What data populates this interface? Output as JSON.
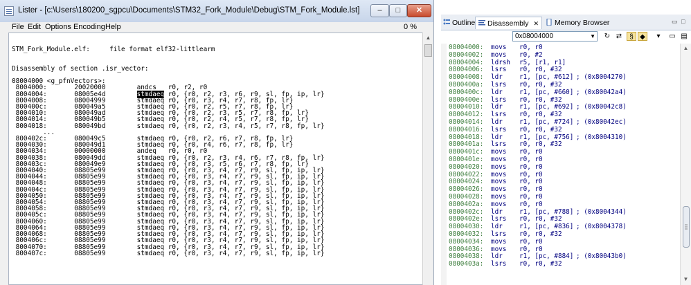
{
  "lister": {
    "title": "Lister - [c:\\Users\\180200_sgpcu\\Documents\\STM32_Fork_Module\\Debug\\STM_Fork_Module.lst]",
    "window_buttons": {
      "minimize": "–",
      "maximize": "□",
      "close": "✕"
    },
    "menu": [
      "File",
      "Edit",
      "Options",
      "Encoding",
      "Help"
    ],
    "percent": "0 %",
    "lines_before": [
      "",
      "STM_Fork_Module.elf:     file format elf32-littlearm",
      "",
      "",
      "Disassembly of section .isr_vector:",
      "",
      "08004000 <g_pfnVectors>:",
      " 8004000:       20020000        andcs   r0, r2, r0"
    ],
    "highlight_line": {
      "prefix": " 8004004:       08005e4d        ",
      "highlight": "stmdaeq",
      "suffix": " r0, {r0, r2, r3, r6, r9, sl, fp, ip, lr}"
    },
    "lines_after": [
      " 8004008:       08004999        stmdaeq r0, {r0, r3, r4, r7, r8, fp, lr}",
      " 800400c:       080049a5        stmdaeq r0, {r0, r2, r5, r7, r8, fp, lr}",
      " 8004010:       080049ad        stmdaeq r0, {r0, r2, r3, r5, r7, r8, fp, lr}",
      " 8004014:       080049b5        stmdaeq r0, {r0, r2, r4, r5, r7, r8, fp, lr}",
      " 8004018:       080049bd        stmdaeq r0, {r0, r2, r3, r4, r5, r7, r8, fp, lr}",
      "        ...",
      " 800402c:       080049c5        stmdaeq r0, {r0, r2, r6, r7, r8, fp, lr}",
      " 8004030:       080049d1        stmdaeq r0, {r0, r4, r6, r7, r8, fp, lr}",
      " 8004034:       00000000        andeq   r0, r0, r0",
      " 8004038:       080049dd        stmdaeq r0, {r0, r2, r3, r4, r6, r7, r8, fp, lr}",
      " 800403c:       080049e9        stmdaeq r0, {r0, r3, r5, r6, r7, r8, fp, lr}",
      " 8004040:       08805e99        stmdaeq r0, {r0, r3, r4, r7, r9, sl, fp, ip, lr}",
      " 8004044:       08805e99        stmdaeq r0, {r0, r3, r4, r7, r9, sl, fp, ip, lr}",
      " 8004048:       08805e99        stmdaeq r0, {r0, r3, r4, r7, r9, sl, fp, ip, lr}",
      " 800404c:       08805e99        stmdaeq r0, {r0, r3, r4, r7, r9, sl, fp, ip, lr}",
      " 8004050:       08805e99        stmdaeq r0, {r0, r3, r4, r7, r9, sl, fp, ip, lr}",
      " 8004054:       08805e99        stmdaeq r0, {r0, r3, r4, r7, r9, sl, fp, ip, lr}",
      " 8004058:       08805e99        stmdaeq r0, {r0, r3, r4, r7, r9, sl, fp, ip, lr}",
      " 800405c:       08805e99        stmdaeq r0, {r0, r3, r4, r7, r9, sl, fp, ip, lr}",
      " 8004060:       08805e99        stmdaeq r0, {r0, r3, r4, r7, r9, sl, fp, ip, lr}",
      " 8004064:       08805e99        stmdaeq r0, {r0, r3, r4, r7, r9, sl, fp, ip, lr}",
      " 8004068:       08805e99        stmdaeq r0, {r0, r3, r4, r7, r9, sl, fp, ip, lr}",
      " 800406c:       08805e99        stmdaeq r0, {r0, r3, r4, r7, r9, sl, fp, ip, lr}",
      " 8004070:       08805e99        stmdaeq r0, {r0, r3, r4, r7, r9, sl, fp, ip, lr}",
      " 800407c:       08805e99        stmdaeq r0, {r0, r3, r4, r7, r9, sl, fp, ip, lr}"
    ]
  },
  "eclipse": {
    "tabs": [
      {
        "label": "Outline",
        "icon": "outline-icon"
      },
      {
        "label": "Disassembly",
        "icon": "disassembly-icon",
        "active": true
      },
      {
        "label": "Memory Browser",
        "icon": "memory-browser-icon"
      }
    ],
    "tab_controls": {
      "minimize": "▭",
      "maximize": "□"
    },
    "address_value": "0x08004000",
    "toolbar_icons": [
      "refresh-icon",
      "link-icon",
      "source-icon",
      "symbols-icon",
      "menu-icon"
    ],
    "rows": [
      {
        "addr": "08004000:",
        "mnem": "movs",
        "ops": "r0, r0",
        "cmt": ""
      },
      {
        "addr": "08004002:",
        "mnem": "movs",
        "ops": "r0, #2",
        "cmt": ""
      },
      {
        "addr": "08004004:",
        "mnem": "ldrsh",
        "ops": "r5, [r1, r1]",
        "cmt": ""
      },
      {
        "addr": "08004006:",
        "mnem": "lsrs",
        "ops": "r0, r0, #32",
        "cmt": ""
      },
      {
        "addr": "08004008:",
        "mnem": "ldr",
        "ops": "r1, [pc, #612]",
        "cmt": "; (0x8004270)"
      },
      {
        "addr": "0800400a:",
        "mnem": "lsrs",
        "ops": "r0, r0, #32",
        "cmt": ""
      },
      {
        "addr": "0800400c:",
        "mnem": "ldr",
        "ops": "r1, [pc, #660]",
        "cmt": "; (0x80042a4)"
      },
      {
        "addr": "0800400e:",
        "mnem": "lsrs",
        "ops": "r0, r0, #32",
        "cmt": ""
      },
      {
        "addr": "08004010:",
        "mnem": "ldr",
        "ops": "r1, [pc, #692]",
        "cmt": "; (0x80042c8)"
      },
      {
        "addr": "08004012:",
        "mnem": "lsrs",
        "ops": "r0, r0, #32",
        "cmt": ""
      },
      {
        "addr": "08004014:",
        "mnem": "ldr",
        "ops": "r1, [pc, #724]",
        "cmt": "; (0x80042ec)"
      },
      {
        "addr": "08004016:",
        "mnem": "lsrs",
        "ops": "r0, r0, #32",
        "cmt": ""
      },
      {
        "addr": "08004018:",
        "mnem": "ldr",
        "ops": "r1, [pc, #756]",
        "cmt": "; (0x8004310)"
      },
      {
        "addr": "0800401a:",
        "mnem": "lsrs",
        "ops": "r0, r0, #32",
        "cmt": ""
      },
      {
        "addr": "0800401c:",
        "mnem": "movs",
        "ops": "r0, r0",
        "cmt": ""
      },
      {
        "addr": "0800401e:",
        "mnem": "movs",
        "ops": "r0, r0",
        "cmt": ""
      },
      {
        "addr": "08004020:",
        "mnem": "movs",
        "ops": "r0, r0",
        "cmt": ""
      },
      {
        "addr": "08004022:",
        "mnem": "movs",
        "ops": "r0, r0",
        "cmt": ""
      },
      {
        "addr": "08004024:",
        "mnem": "movs",
        "ops": "r0, r0",
        "cmt": ""
      },
      {
        "addr": "08004026:",
        "mnem": "movs",
        "ops": "r0, r0",
        "cmt": ""
      },
      {
        "addr": "08004028:",
        "mnem": "movs",
        "ops": "r0, r0",
        "cmt": ""
      },
      {
        "addr": "0800402a:",
        "mnem": "movs",
        "ops": "r0, r0",
        "cmt": ""
      },
      {
        "addr": "0800402c:",
        "mnem": "ldr",
        "ops": "r1, [pc, #788]",
        "cmt": "; (0x8004344)"
      },
      {
        "addr": "0800402e:",
        "mnem": "lsrs",
        "ops": "r0, r0, #32",
        "cmt": ""
      },
      {
        "addr": "08004030:",
        "mnem": "ldr",
        "ops": "r1, [pc, #836]",
        "cmt": "; (0x8004378)"
      },
      {
        "addr": "08004032:",
        "mnem": "lsrs",
        "ops": "r0, r0, #32",
        "cmt": ""
      },
      {
        "addr": "08004034:",
        "mnem": "movs",
        "ops": "r0, r0",
        "cmt": ""
      },
      {
        "addr": "08004036:",
        "mnem": "movs",
        "ops": "r0, r0",
        "cmt": ""
      },
      {
        "addr": "08004038:",
        "mnem": "ldr",
        "ops": "r1, [pc, #884]",
        "cmt": "; (0x80043b0)"
      },
      {
        "addr": "0800403a:",
        "mnem": "lsrs",
        "ops": "r0, r0, #32",
        "cmt": ""
      }
    ]
  }
}
